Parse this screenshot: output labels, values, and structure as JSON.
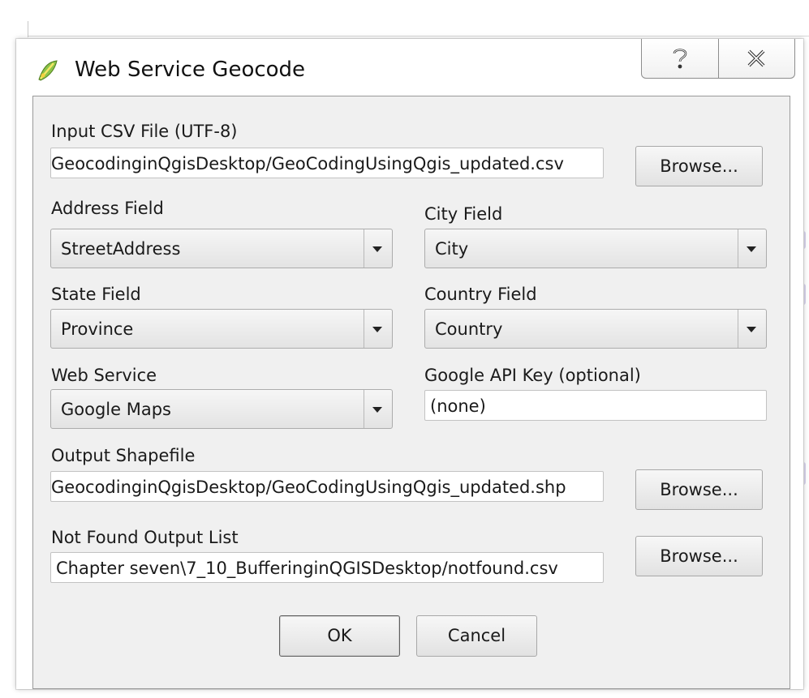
{
  "window": {
    "title": "Web Service Geocode",
    "icon": "qgis-logo-icon"
  },
  "fields": {
    "input_csv": {
      "label": "Input CSV File (UTF-8)",
      "value": "GeocodinginQgisDesktop/GeoCodingUsingQgis_updated.csv",
      "browse_label": "Browse..."
    },
    "address": {
      "label": "Address Field",
      "value": "StreetAddress"
    },
    "city": {
      "label": "City Field",
      "value": "City"
    },
    "state": {
      "label": "State Field",
      "value": "Province"
    },
    "country": {
      "label": "Country Field",
      "value": "Country"
    },
    "web_service": {
      "label": "Web Service",
      "value": "Google Maps"
    },
    "api_key": {
      "label": "Google API Key (optional)",
      "value": "(none)"
    },
    "output_shapefile": {
      "label": "Output Shapefile",
      "value": "GeocodinginQgisDesktop/GeoCodingUsingQgis_updated.shp",
      "browse_label": "Browse..."
    },
    "not_found": {
      "label": "Not Found Output List",
      "value": "Chapter seven\\7_10_BufferinginQGISDesktop/notfound.csv",
      "browse_label": "Browse..."
    }
  },
  "buttons": {
    "ok": "OK",
    "cancel": "Cancel"
  },
  "colors": {
    "client_bg": "#f0f0f0",
    "accent_icon": "#7cb342"
  }
}
